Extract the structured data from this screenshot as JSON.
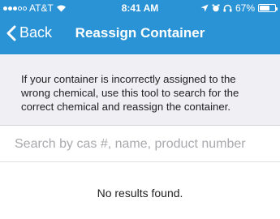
{
  "status_bar": {
    "carrier": "AT&T",
    "time": "8:41 AM",
    "battery": "67%",
    "battery_level": 0.67
  },
  "nav": {
    "back_label": "Back",
    "title": "Reassign Container"
  },
  "info": {
    "text": "If your container is incorrectly assigned to the wrong chemical, use this tool to search for the correct chemical and reassign the container."
  },
  "search": {
    "placeholder": "Search by cas #, name, product number",
    "value": ""
  },
  "results": {
    "empty_message": "No results found."
  },
  "colors": {
    "brand": "#2a93d5",
    "info_background": "#efeff4"
  }
}
